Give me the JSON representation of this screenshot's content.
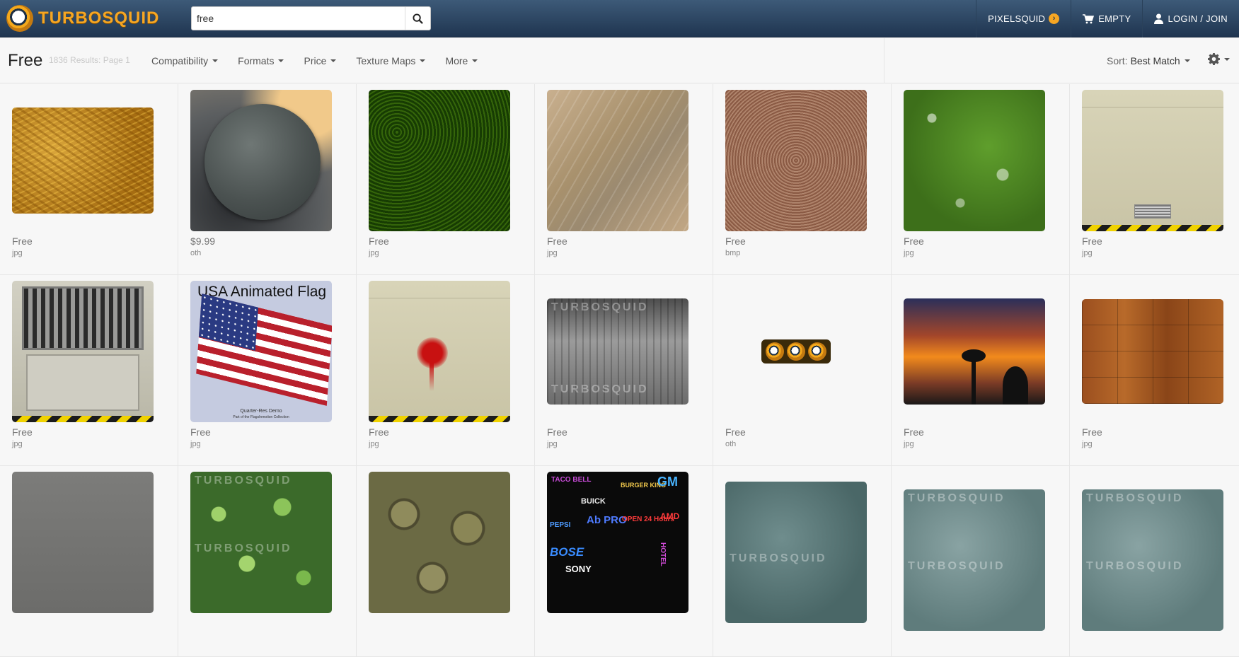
{
  "header": {
    "logo_text": "TURBOSQUID",
    "search_value": "free",
    "nav": [
      {
        "label": "PIXELSQUID"
      },
      {
        "label": "EMPTY"
      },
      {
        "label": "LOGIN / JOIN"
      }
    ]
  },
  "filterbar": {
    "title": "Free",
    "results": "1836 Results: Page 1",
    "filters": [
      "Compatibility",
      "Formats",
      "Price",
      "Texture Maps",
      "More"
    ],
    "sort_label": "Sort:",
    "sort_value": "Best Match"
  },
  "products": [
    {
      "price": "Free",
      "format": "jpg"
    },
    {
      "price": "$9.99",
      "format": "oth"
    },
    {
      "price": "Free",
      "format": "jpg"
    },
    {
      "price": "Free",
      "format": "jpg"
    },
    {
      "price": "Free",
      "format": "bmp"
    },
    {
      "price": "Free",
      "format": "jpg"
    },
    {
      "price": "Free",
      "format": "jpg"
    },
    {
      "price": "Free",
      "format": "jpg"
    },
    {
      "price": "Free",
      "format": "jpg",
      "thumb_title": "USA Animated Flag",
      "thumb_caption": "Quarter-Res Demo",
      "thumb_subcaption": "Part of the FlagsInmotion Collection"
    },
    {
      "price": "Free",
      "format": "jpg"
    },
    {
      "price": "Free",
      "format": "jpg"
    },
    {
      "price": "Free",
      "format": "oth"
    },
    {
      "price": "Free",
      "format": "jpg"
    },
    {
      "price": "Free",
      "format": "jpg"
    },
    {},
    {},
    {},
    {},
    {},
    {},
    {}
  ],
  "watermark": "TURBOSQUID",
  "neon_signs": [
    "TACO BELL",
    "BUICK",
    "BURGER KING",
    "GM",
    "PEPSI",
    "Ab PRO",
    "OPEN 24 Hours",
    "AMD",
    "BOSE",
    "SONY",
    "HOTEL"
  ],
  "colors": {
    "header_top": "#3d5a78",
    "header_bottom": "#1f3550",
    "logo": "#f6a623",
    "page_bg": "#f7f7f7"
  }
}
